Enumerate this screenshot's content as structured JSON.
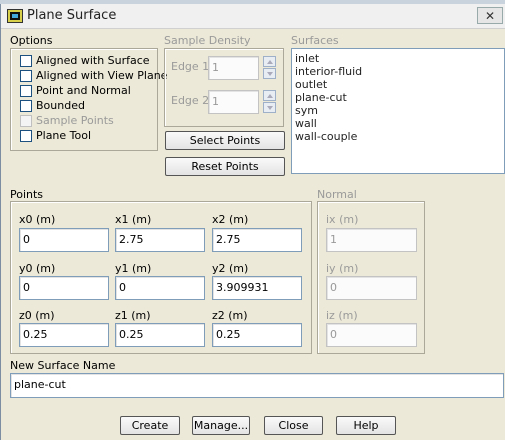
{
  "window": {
    "title": "Plane Surface",
    "close_glyph": "✕"
  },
  "options": {
    "label": "Options",
    "items": [
      {
        "label": "Aligned with Surface",
        "checked": false,
        "enabled": true
      },
      {
        "label": "Aligned with View Plane",
        "checked": false,
        "enabled": true
      },
      {
        "label": "Point and Normal",
        "checked": false,
        "enabled": true
      },
      {
        "label": "Bounded",
        "checked": false,
        "enabled": true
      },
      {
        "label": "Sample Points",
        "checked": false,
        "enabled": false
      },
      {
        "label": "Plane Tool",
        "checked": false,
        "enabled": true
      }
    ]
  },
  "sample_density": {
    "label": "Sample Density",
    "edge1_label": "Edge 1",
    "edge1_value": "1",
    "edge2_label": "Edge 2",
    "edge2_value": "1"
  },
  "buttons": {
    "select_points": "Select Points",
    "reset_points": "Reset Points",
    "create": "Create",
    "manage": "Manage...",
    "close": "Close",
    "help": "Help"
  },
  "surfaces": {
    "label": "Surfaces",
    "items": [
      "inlet",
      "interior-fluid",
      "outlet",
      "plane-cut",
      "sym",
      "wall",
      "wall-couple"
    ]
  },
  "points": {
    "label": "Points",
    "x0_label": "x0 (m)",
    "x0": "0",
    "x1_label": "x1 (m)",
    "x1": "2.75",
    "x2_label": "x2 (m)",
    "x2": "2.75",
    "y0_label": "y0 (m)",
    "y0": "0",
    "y1_label": "y1 (m)",
    "y1": "0",
    "y2_label": "y2 (m)",
    "y2": "3.909931",
    "z0_label": "z0 (m)",
    "z0": "0.25",
    "z1_label": "z1 (m)",
    "z1": "0.25",
    "z2_label": "z2 (m)",
    "z2": "0.25"
  },
  "normal": {
    "label": "Normal",
    "ix_label": "ix (m)",
    "ix": "1",
    "iy_label": "iy (m)",
    "iy": "0",
    "iz_label": "iz (m)",
    "iz": "0"
  },
  "new_surface": {
    "label": "New Surface Name",
    "value": "plane-cut"
  }
}
